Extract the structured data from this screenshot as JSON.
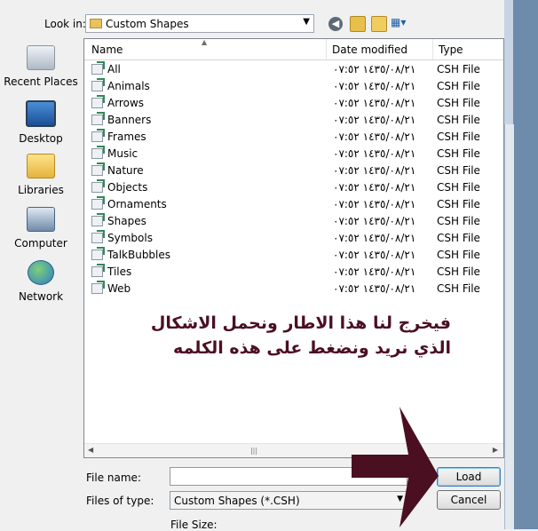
{
  "look_in": {
    "label": "Look in:",
    "value": "Custom Shapes"
  },
  "places": [
    {
      "label": "Recent Places",
      "icon": "recent-places-icon"
    },
    {
      "label": "Desktop",
      "icon": "desktop-icon"
    },
    {
      "label": "Libraries",
      "icon": "libraries-icon"
    },
    {
      "label": "Computer",
      "icon": "computer-icon"
    },
    {
      "label": "Network",
      "icon": "network-icon"
    }
  ],
  "columns": {
    "name": "Name",
    "date_modified": "Date modified",
    "type": "Type"
  },
  "files": [
    {
      "name": "All",
      "date": "١٤٣٥/٠٨/٢١ ٠٧:٥٢",
      "type": "CSH File"
    },
    {
      "name": "Animals",
      "date": "١٤٣٥/٠٨/٢١ ٠٧:٥٢",
      "type": "CSH File"
    },
    {
      "name": "Arrows",
      "date": "١٤٣٥/٠٨/٢١ ٠٧:٥٢",
      "type": "CSH File"
    },
    {
      "name": "Banners",
      "date": "١٤٣٥/٠٨/٢١ ٠٧:٥٢",
      "type": "CSH File"
    },
    {
      "name": "Frames",
      "date": "١٤٣٥/٠٨/٢١ ٠٧:٥٢",
      "type": "CSH File"
    },
    {
      "name": "Music",
      "date": "١٤٣٥/٠٨/٢١ ٠٧:٥٢",
      "type": "CSH File"
    },
    {
      "name": "Nature",
      "date": "١٤٣٥/٠٨/٢١ ٠٧:٥٢",
      "type": "CSH File"
    },
    {
      "name": "Objects",
      "date": "١٤٣٥/٠٨/٢١ ٠٧:٥٢",
      "type": "CSH File"
    },
    {
      "name": "Ornaments",
      "date": "١٤٣٥/٠٨/٢١ ٠٧:٥٢",
      "type": "CSH File"
    },
    {
      "name": "Shapes",
      "date": "١٤٣٥/٠٨/٢١ ٠٧:٥٢",
      "type": "CSH File"
    },
    {
      "name": "Symbols",
      "date": "١٤٣٥/٠٨/٢١ ٠٧:٥٢",
      "type": "CSH File"
    },
    {
      "name": "TalkBubbles",
      "date": "١٤٣٥/٠٨/٢١ ٠٧:٥٢",
      "type": "CSH File"
    },
    {
      "name": "Tiles",
      "date": "١٤٣٥/٠٨/٢١ ٠٧:٥٢",
      "type": "CSH File"
    },
    {
      "name": "Web",
      "date": "١٤٣٥/٠٨/٢١ ٠٧:٥٢",
      "type": "CSH File"
    }
  ],
  "form": {
    "file_name_label": "File name:",
    "file_name_value": "",
    "files_of_type_label": "Files of type:",
    "files_of_type_value": "Custom Shapes (*.CSH)",
    "file_size_label": "File Size:"
  },
  "buttons": {
    "load": "Load",
    "cancel": "Cancel"
  },
  "annotation": {
    "line1": "فيخرج لنا هذا الاطار ونحمل الاشكال",
    "line2": "الذي نريد ونضغط على هذه الكلمه"
  },
  "colors": {
    "annotation": "#4b0f22",
    "window_frame": "#6d8bab"
  }
}
